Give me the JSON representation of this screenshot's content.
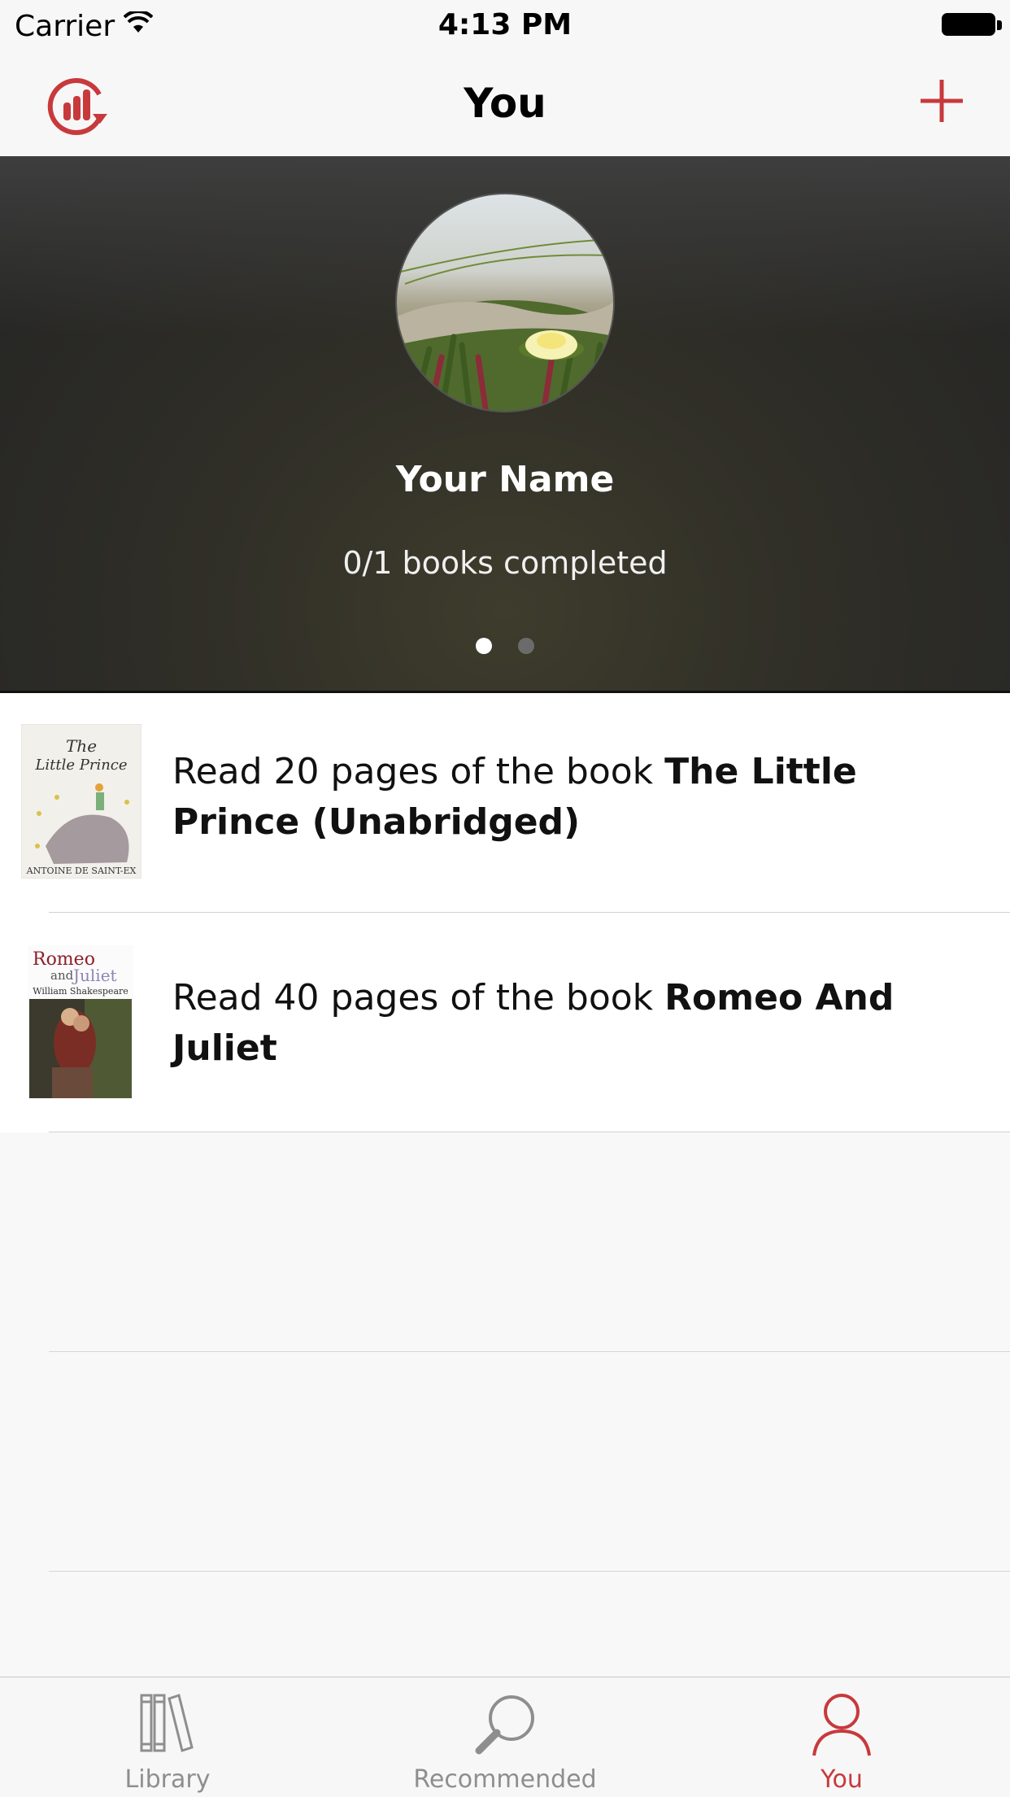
{
  "status_bar": {
    "carrier": "Carrier",
    "time": "4:13 PM"
  },
  "nav": {
    "title": "You",
    "left_icon": "stats-refresh-icon",
    "right_icon": "plus-icon"
  },
  "profile": {
    "name": "Your Name",
    "completed": "0/1 books completed",
    "pages": 2,
    "current_page": 1
  },
  "goals": [
    {
      "prefix": "Read 20 pages of the book ",
      "book": "The Little Prince (Unabridged)",
      "cover_icon": "little-prince-cover"
    },
    {
      "prefix": "Read 40 pages of the book ",
      "book": "Romeo And Juliet",
      "cover_icon": "romeo-juliet-cover"
    }
  ],
  "covers": {
    "little_prince": {
      "line1": "The",
      "line2": "Little Prince",
      "author": "ANTOINE DE SAINT-EX"
    },
    "romeo": {
      "line1": "Romeo",
      "line2a": "and",
      "line2b": "Juliet",
      "author": "William Shakespeare"
    }
  },
  "tabs": [
    {
      "label": "Library",
      "icon": "library-icon",
      "active": false
    },
    {
      "label": "Recommended",
      "icon": "search-icon",
      "active": false
    },
    {
      "label": "You",
      "icon": "person-icon",
      "active": true
    }
  ],
  "colors": {
    "accent": "#c8393c",
    "inactive": "#8e8e8e"
  }
}
